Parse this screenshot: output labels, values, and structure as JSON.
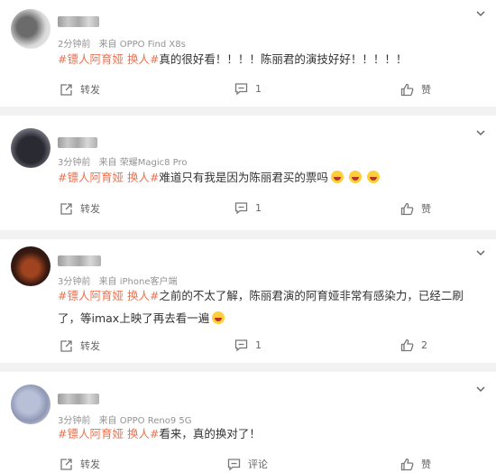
{
  "comments": [
    {
      "time": "2分钟前",
      "source": "来自 OPPO Find X8s",
      "tag": "#镖人阿育娅 换人#",
      "text": "真的很好看！！！！陈丽君的演技好好！！！！！",
      "repost_label": "转发",
      "comment_count": "1",
      "like_label": "赞"
    },
    {
      "time": "3分钟前",
      "source": "来自 荣耀Magic8 Pro",
      "tag": "#镖人阿育娅 换人#",
      "text": "难道只有我是因为陈丽君买的票吗",
      "repost_label": "转发",
      "comment_count": "1",
      "like_label": "赞"
    },
    {
      "time": "3分钟前",
      "source": "来自 iPhone客户端",
      "tag": "#镖人阿育娅 换人#",
      "text": "之前的不太了解，陈丽君演的阿育娅非常有感染力，已经二刷了，等imax上映了再去看一遍",
      "repost_label": "转发",
      "comment_count": "1",
      "like_count": "2"
    },
    {
      "time": "3分钟前",
      "source": "来自 OPPO Reno9 5G",
      "tag": "#镖人阿育娅 换人#",
      "text": "看来，真的换对了！",
      "repost_label": "转发",
      "comment_label": "评论",
      "like_label": "赞"
    }
  ],
  "icons": {
    "repost": "repost-icon",
    "comment": "comment-icon",
    "like": "like-icon",
    "more": "chevron-down-icon",
    "emoji": "laughing-emoji-icon"
  },
  "colors": {
    "hashtag": "#eb7350",
    "separator": "#f2f2f2"
  }
}
